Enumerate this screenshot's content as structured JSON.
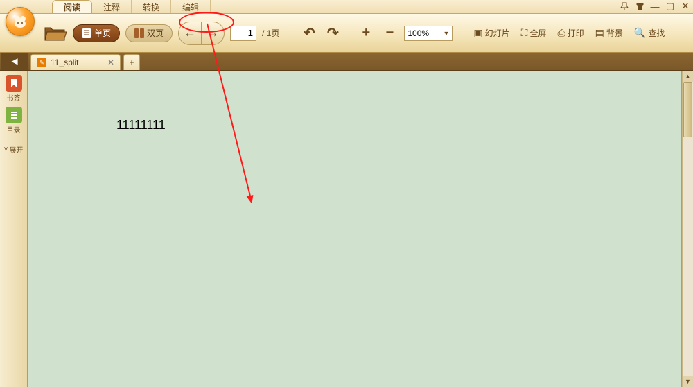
{
  "menu": {
    "tabs": [
      "阅读",
      "注释",
      "转换",
      "编辑"
    ],
    "active_index": 0
  },
  "window_controls": {
    "pin": "📌",
    "skin": "👕",
    "min": "—",
    "max": "▢",
    "close": "✕"
  },
  "toolbar": {
    "single_page": "单页",
    "double_page": "双页",
    "page_current": "1",
    "page_total": "/ 1页",
    "zoom_value": "100%",
    "slideshow": "幻灯片",
    "fullscreen": "全屏",
    "print": "打印",
    "background": "背景",
    "find": "查找"
  },
  "doc_tabs": {
    "items": [
      {
        "name": "11_split"
      }
    ]
  },
  "sidebar": {
    "bookmark": "书签",
    "toc": "目录",
    "expand": "展开"
  },
  "document": {
    "content": "11111111"
  }
}
